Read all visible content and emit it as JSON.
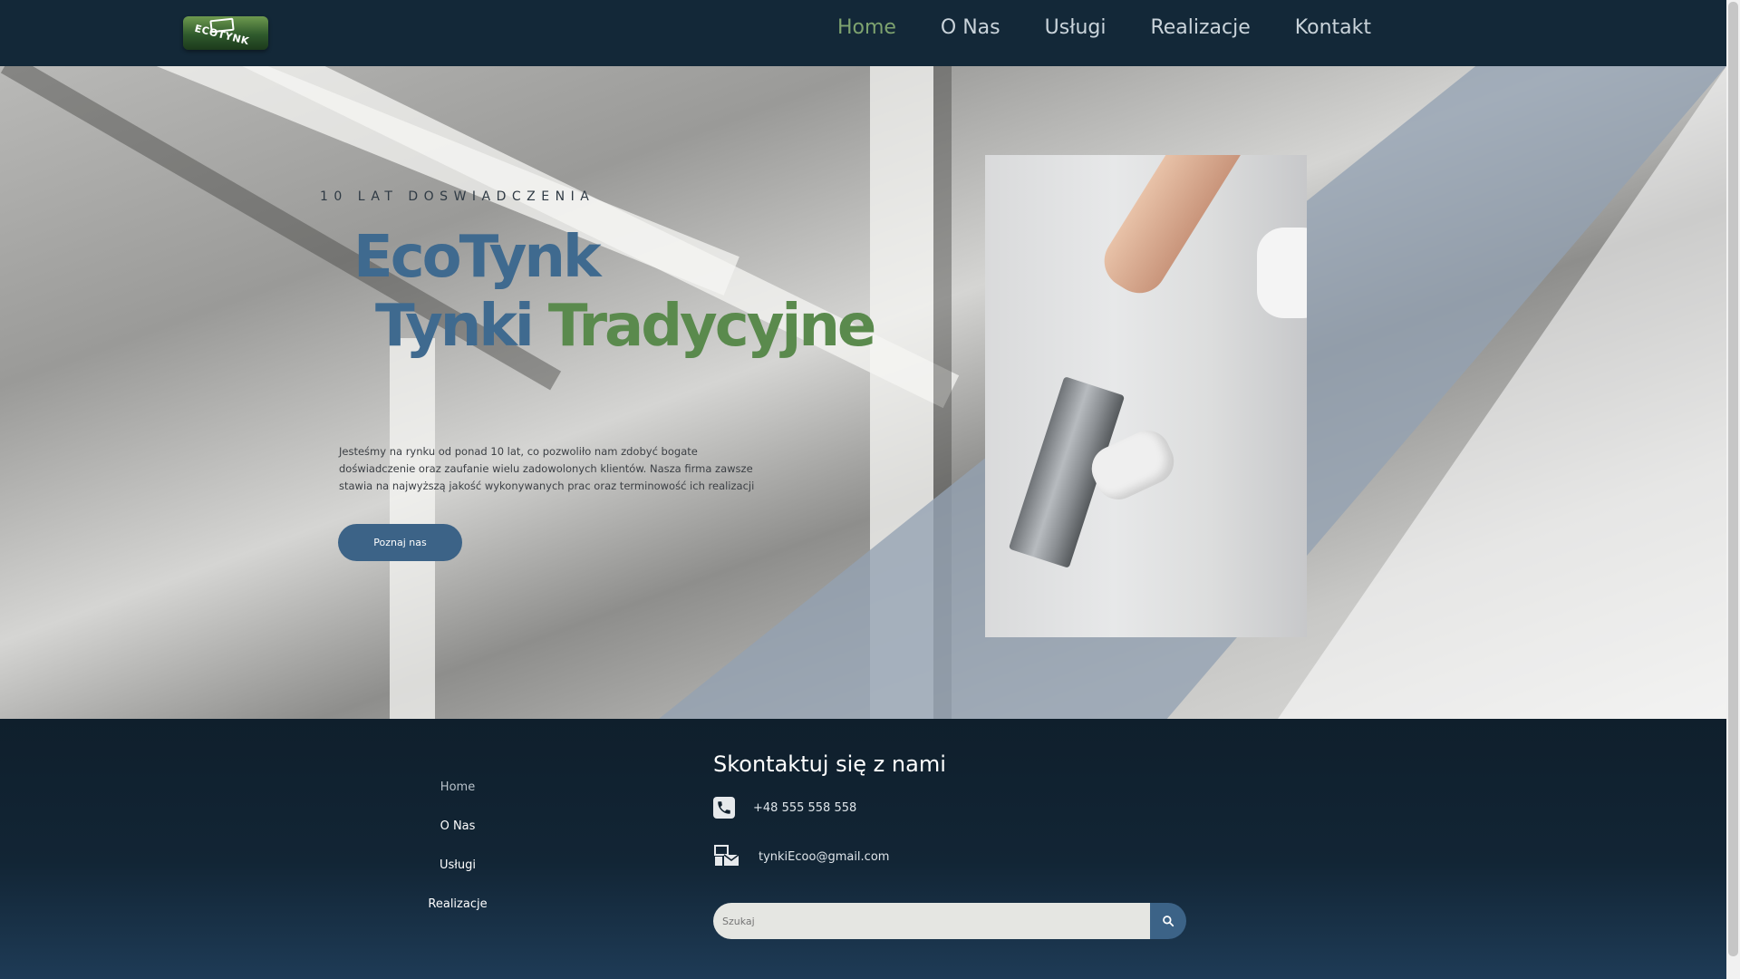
{
  "header": {
    "logo_text": "ECOTYNK",
    "nav": [
      {
        "label": "Home",
        "active": true
      },
      {
        "label": "O Nas",
        "active": false
      },
      {
        "label": "Usługi",
        "active": false
      },
      {
        "label": "Realizacje",
        "active": false
      },
      {
        "label": "Kontakt",
        "active": false
      }
    ]
  },
  "hero": {
    "kicker": "10 LAT DOSWIADCZENIA",
    "title_line1": "EcoTynk",
    "title_line2_word1": "Tynki",
    "title_line2_word2": "Tradycyjne",
    "paragraph": "Jesteśmy na rynku od ponad 10 lat, co pozwoliło nam zdobyć bogate doświadczenie oraz zaufanie wielu zadowolonych klientów. Nasza firma zawsze stawia na najwyższą jakość wykonywanych prac oraz terminowość ich realizacji",
    "cta_label": "Poznaj nas"
  },
  "footer": {
    "nav": [
      "Home",
      "O Nas",
      "Usługi",
      "Realizacje"
    ],
    "contact_title": "Skontaktuj się z nami",
    "phone": "+48 555 558 558",
    "email": "tynkiEcoo@gmail.com",
    "search_placeholder": "Szukaj"
  },
  "colors": {
    "header_bg": "#132838",
    "nav_active": "#7ea36f",
    "primary_blue": "#3f6a8f",
    "accent_green": "#5a8a4d",
    "button_bg": "#3c6387"
  }
}
